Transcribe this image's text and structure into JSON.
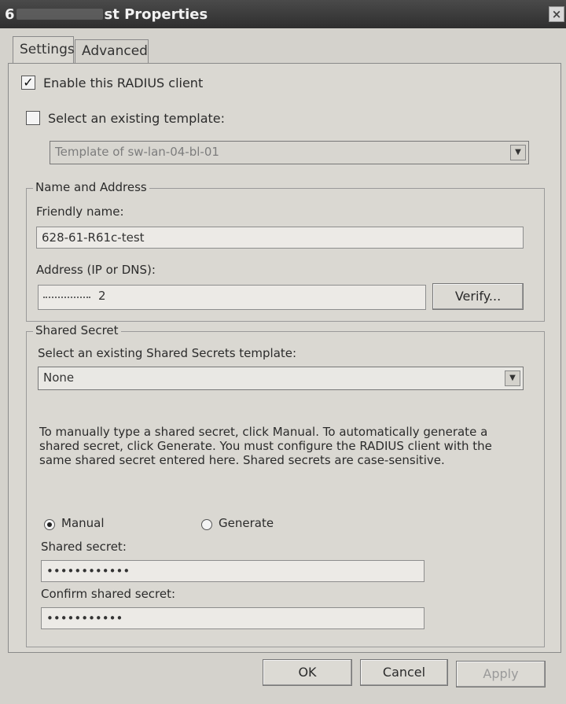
{
  "window": {
    "title_prefix": "6",
    "title_suffix": "st Properties",
    "close_label": "×"
  },
  "tabs": [
    {
      "label": "Settings",
      "active": true
    },
    {
      "label": "Advanced",
      "active": false
    }
  ],
  "settings": {
    "enable_client": {
      "label": "Enable this RADIUS client",
      "checked": true
    },
    "select_template": {
      "label": "Select an existing template:",
      "checked": false
    },
    "template_combo": {
      "value": "Template of sw-lan-04-bl-01"
    },
    "name_address": {
      "group_title": "Name and Address",
      "friendly_name_label": "Friendly name:",
      "friendly_name_value": "628-61-R61c-test",
      "address_label": "Address (IP or DNS):",
      "address_value": "2",
      "verify_label": "Verify..."
    },
    "shared_secret": {
      "group_title": "Shared Secret",
      "template_label": "Select an existing Shared Secrets template:",
      "template_value": "None",
      "description": "To manually type a shared secret, click Manual. To automatically generate a shared secret, click Generate. You must configure the RADIUS client with the same shared secret entered here. Shared secrets are case-sensitive.",
      "manual_label": "Manual",
      "generate_label": "Generate",
      "selected": "Manual",
      "secret_label": "Shared secret:",
      "secret_value": "••••••••••••",
      "confirm_label": "Confirm shared secret:",
      "confirm_value": "•••••••••••"
    }
  },
  "buttons": {
    "ok": "OK",
    "cancel": "Cancel",
    "apply": "Apply"
  }
}
